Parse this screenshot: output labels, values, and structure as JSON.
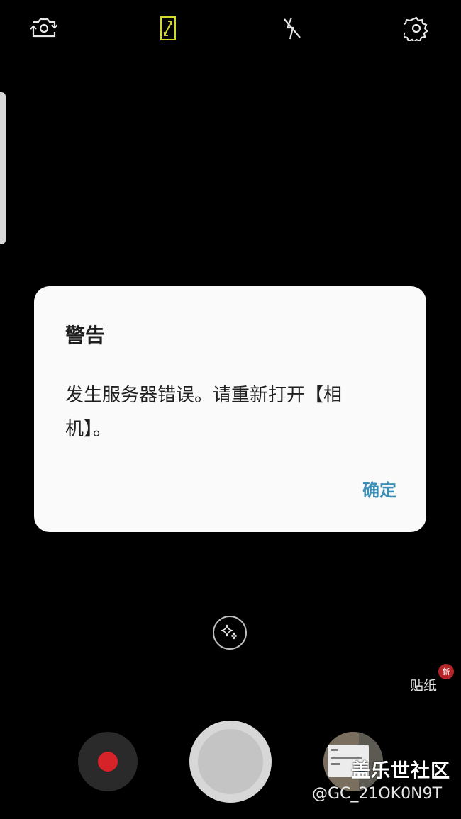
{
  "toolbar": {
    "icons": [
      "switch-camera-icon",
      "aspect-ratio-icon",
      "flash-off-icon",
      "settings-gear-icon"
    ],
    "accent_color": "#d4d62a"
  },
  "dialog": {
    "title": "警告",
    "message": "发生服务器错误。请重新打开【相机】。",
    "ok_label": "确定"
  },
  "controls": {
    "effects_icon": "sparkle-icon",
    "sticker_label": "贴纸",
    "sticker_badge": "新",
    "record_icon": "record-icon",
    "gallery_icon": "gallery-thumbnail"
  },
  "watermark": {
    "logo_text": "盖乐世社区",
    "user_text": "@GC_21OK0N9T"
  },
  "colors": {
    "background": "#000000",
    "dialog_bg": "#fafafa",
    "ok_color": "#3e8fb5",
    "record_red": "#d62329",
    "badge_red": "#b5262a"
  }
}
